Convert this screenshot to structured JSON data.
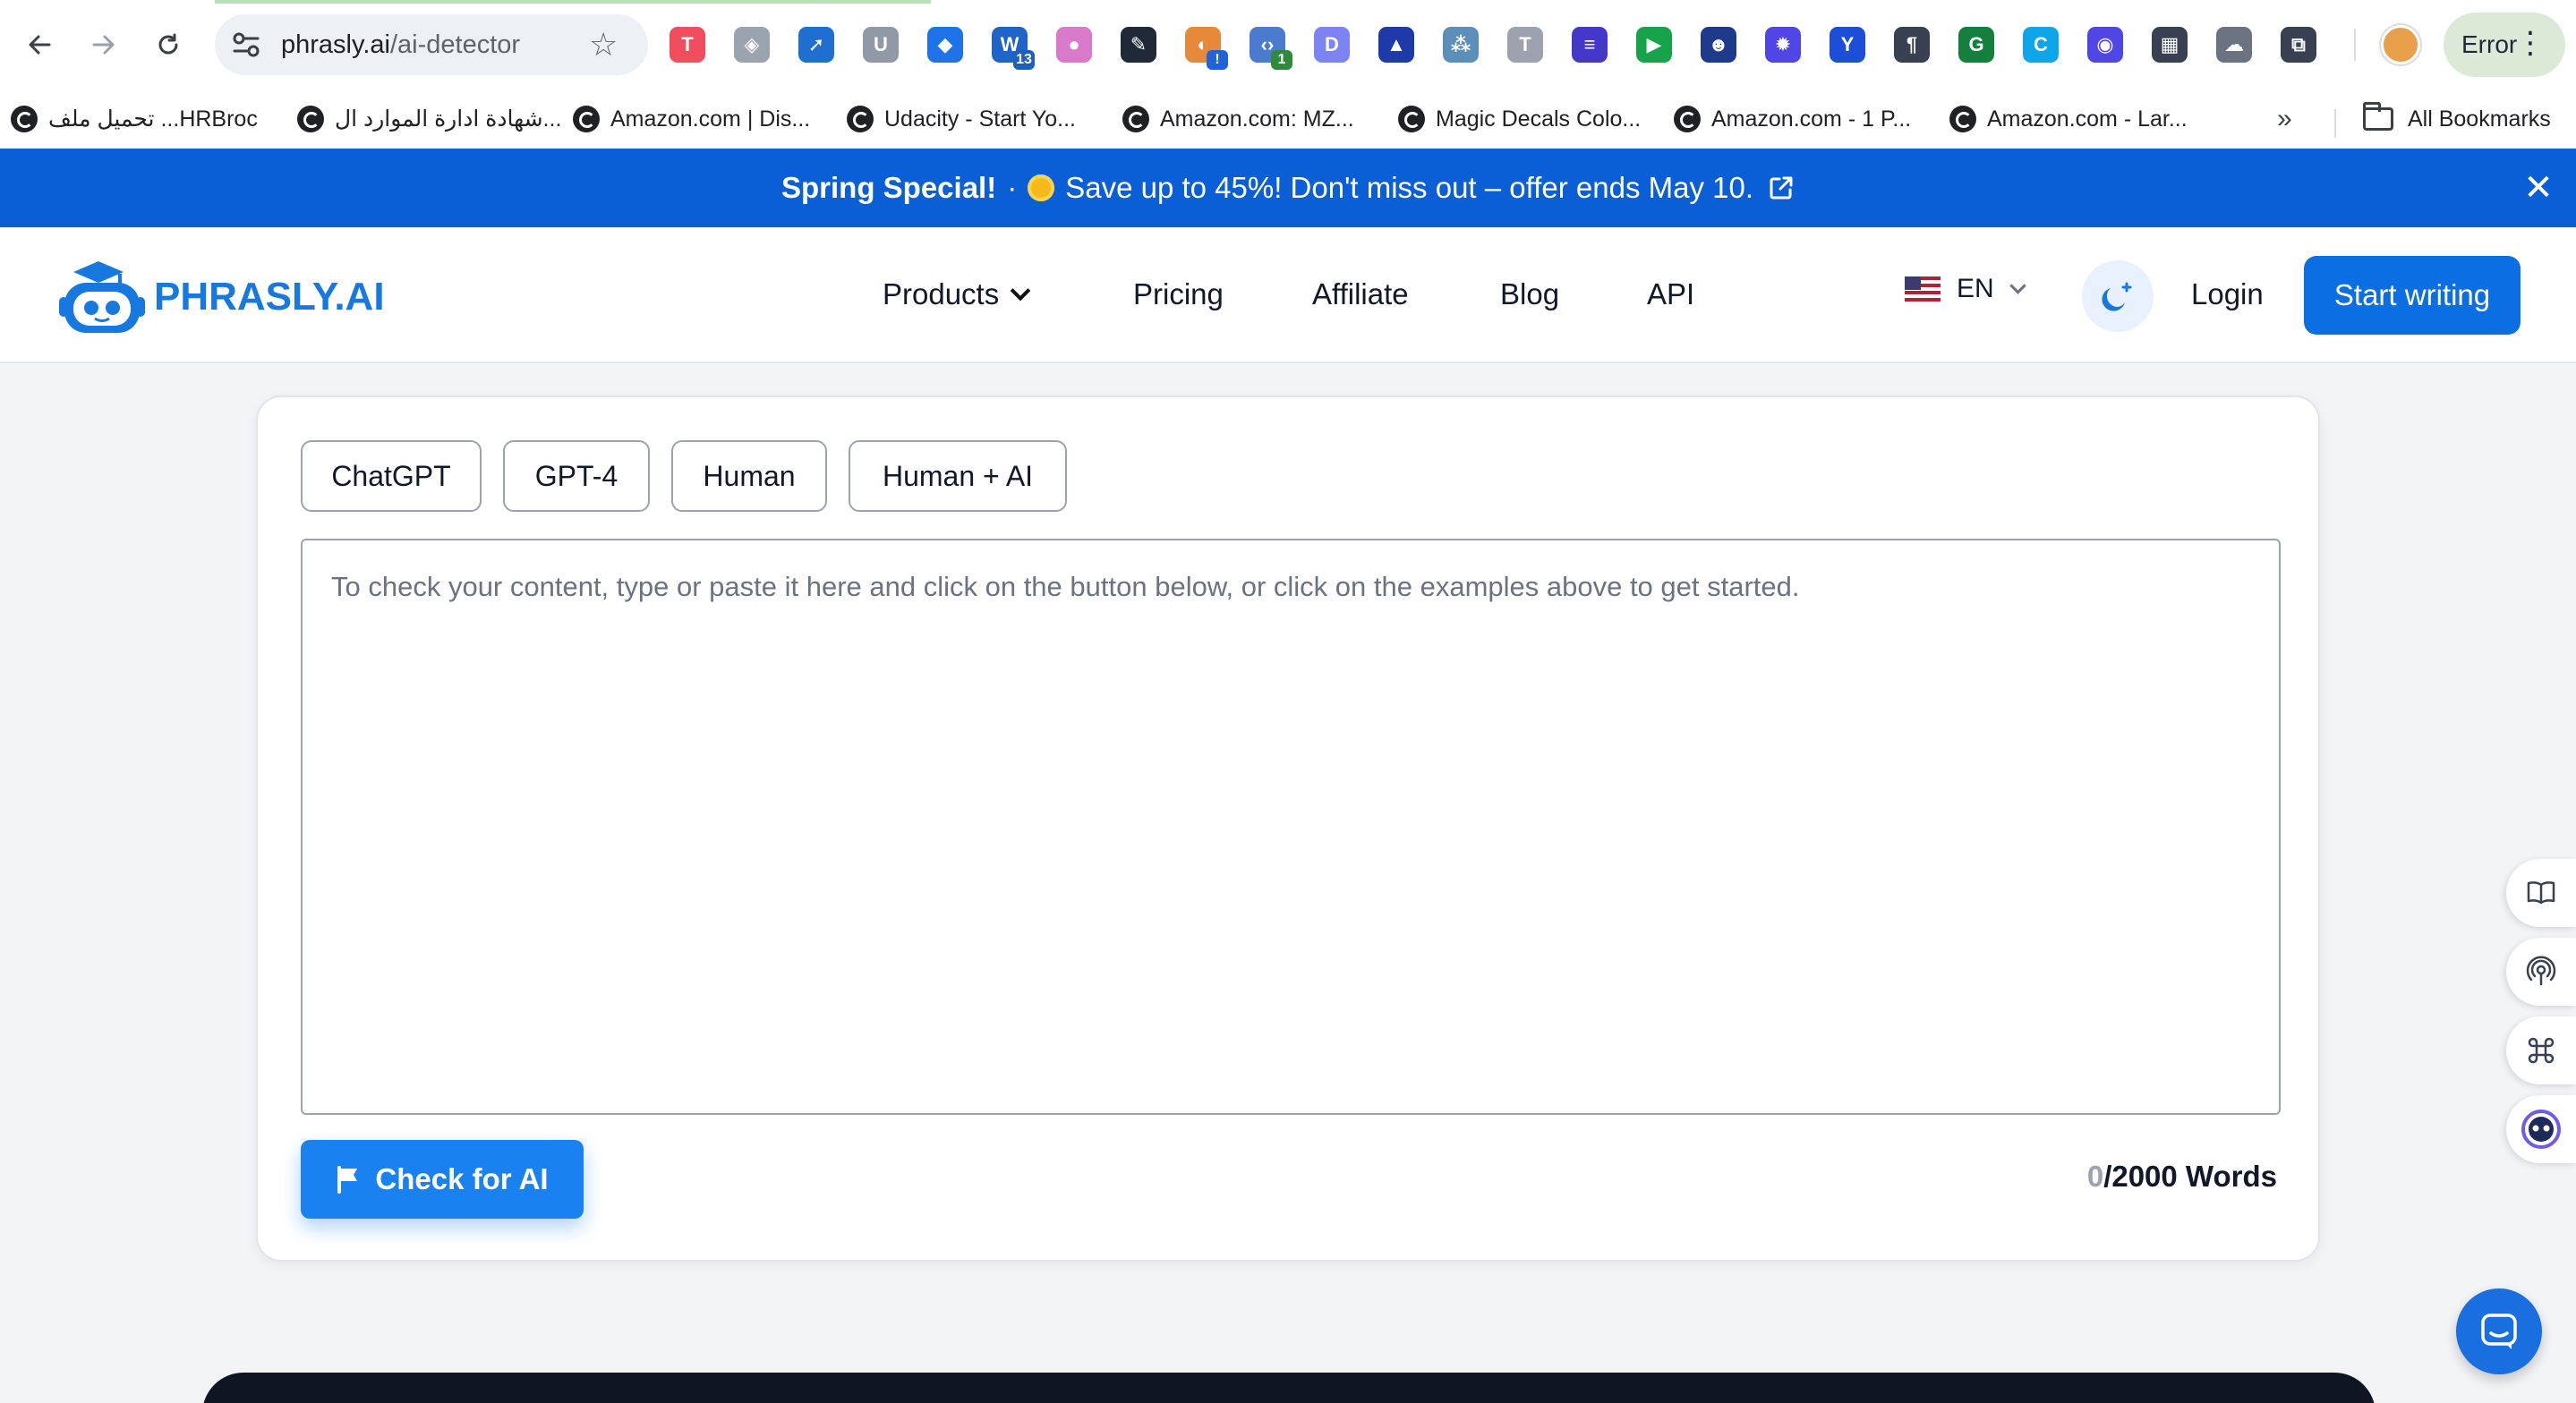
{
  "browser": {
    "url_host": "phrasly.ai",
    "url_path": "/ai-detector",
    "error_label": "Error",
    "extensions": [
      {
        "name": "tiktok-ext-icon",
        "color": "#f04e5f",
        "glyph": "T"
      },
      {
        "name": "shield-ext-icon",
        "color": "#9aa3ae",
        "glyph": "◈"
      },
      {
        "name": "send-ext-icon",
        "color": "#1f6fd1",
        "glyph": "➚"
      },
      {
        "name": "u-ext-icon",
        "color": "#8f9aa6",
        "glyph": "U"
      },
      {
        "name": "tag-ext-icon",
        "color": "#1f73e8",
        "glyph": "◆"
      },
      {
        "name": "w-ext-icon",
        "color": "#2064c9",
        "glyph": "W",
        "badge": "13",
        "badge_color": "#1f5fbf"
      },
      {
        "name": "blob-ext-icon",
        "color": "#d979c9",
        "glyph": "●"
      },
      {
        "name": "dropper-ext-icon",
        "color": "#1f2937",
        "glyph": "✎"
      },
      {
        "name": "globe-alert-ext-icon",
        "color": "#e7893a",
        "glyph": "◐",
        "badge": "!",
        "badge_color": "#1f63d6"
      },
      {
        "name": "code-ext-icon",
        "color": "#4b7bcf",
        "glyph": "‹›",
        "badge": "1",
        "badge_color": "#2e8b3e"
      },
      {
        "name": "d-ext-icon",
        "color": "#7c83f2",
        "glyph": "D"
      },
      {
        "name": "tree-ext-icon",
        "color": "#1e3aa8",
        "glyph": "▲"
      },
      {
        "name": "dots-ext-icon",
        "color": "#5b8fb9",
        "glyph": "⁂"
      },
      {
        "name": "t-serif-ext-icon",
        "color": "#9ca3af",
        "glyph": "T"
      },
      {
        "name": "form-ext-icon",
        "color": "#4338ca",
        "glyph": "≡"
      },
      {
        "name": "play-ext-icon",
        "color": "#16a34a",
        "glyph": "▶"
      },
      {
        "name": "alien-ext-icon",
        "color": "#1e3a8a",
        "glyph": "☻"
      },
      {
        "name": "sun-ext-icon",
        "color": "#4f46e5",
        "glyph": "✹"
      },
      {
        "name": "y-ext-icon",
        "color": "#1d4ed8",
        "glyph": "Y"
      },
      {
        "name": "pilcrow-ext-icon",
        "color": "#374151",
        "glyph": "¶"
      },
      {
        "name": "grammarly-ext-icon",
        "color": "#15803d",
        "glyph": "G"
      },
      {
        "name": "c-ext-icon",
        "color": "#0ea5e9",
        "glyph": "C"
      },
      {
        "name": "robot-ext-icon",
        "color": "#4f46e5",
        "glyph": "◉"
      },
      {
        "name": "media-ext-icon",
        "color": "#374151",
        "glyph": "▦"
      },
      {
        "name": "cloud-ext-icon",
        "color": "#6b7280",
        "glyph": "☁"
      },
      {
        "name": "puzzle-ext-icon",
        "color": "#374151",
        "glyph": "⧉"
      }
    ]
  },
  "bookmarks": {
    "items": [
      "تحميل ملف ...HRBroc",
      "شهادة ادارة الموارد ال...",
      "Amazon.com | Dis...",
      "Udacity - Start Yo...",
      "Amazon.com: MZ...",
      "Magic Decals Colo...",
      "Amazon.com - 1 P...",
      "Amazon.com - Lar..."
    ],
    "more": "»",
    "all_bookmarks": "All Bookmarks"
  },
  "promo": {
    "title": "Spring Special!",
    "separator": "·",
    "message": "Save up to 45%! Don't miss out – offer ends May 10.",
    "close": "✕"
  },
  "header": {
    "logo_text": "PHRASLY.AI",
    "nav": [
      "Products",
      "Pricing",
      "Affiliate",
      "Blog",
      "API"
    ],
    "language": "EN",
    "login": "Login",
    "cta": "Start writing"
  },
  "detector": {
    "examples": [
      "ChatGPT",
      "GPT-4",
      "Human",
      "Human + AI"
    ],
    "placeholder": "To check your content, type or paste it here and click on the button below, or click on the examples above to get started.",
    "check_button": "Check for AI",
    "word_count": "0",
    "word_limit": "/2000 Words"
  },
  "colors": {
    "brand_blue": "#0b6ee3",
    "promo_blue": "#0b5fd6",
    "button_blue": "#1a82f0"
  }
}
